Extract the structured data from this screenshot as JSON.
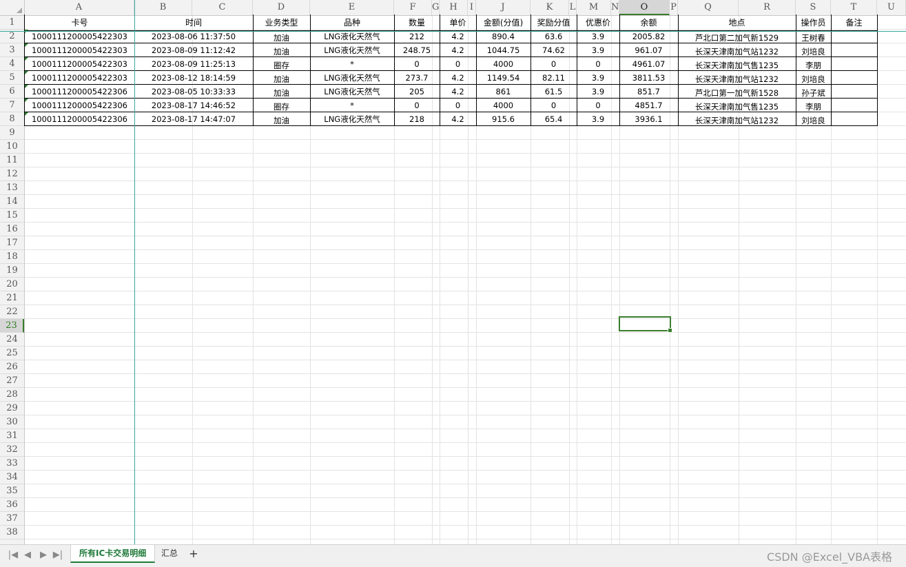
{
  "columns": [
    "A",
    "B",
    "C",
    "D",
    "E",
    "F",
    "G",
    "H",
    "I",
    "J",
    "K",
    "L",
    "M",
    "N",
    "O",
    "P",
    "Q",
    "R",
    "S",
    "T",
    "U"
  ],
  "selected_column": "O",
  "row_numbers": [
    "1",
    "2",
    "3",
    "4",
    "5",
    "6",
    "7",
    "8",
    "9",
    "10",
    "11",
    "12",
    "13",
    "14",
    "15",
    "16",
    "17",
    "18",
    "19",
    "20",
    "21",
    "22",
    "23",
    "24",
    "25",
    "26",
    "27",
    "28",
    "29",
    "30",
    "31",
    "32",
    "33",
    "34",
    "35",
    "36",
    "37",
    "38"
  ],
  "selected_row": "23",
  "headers": [
    "卡号",
    "时间",
    "业务类型",
    "品种",
    "数量",
    "单价",
    "金额(分值)",
    "奖励分值",
    "优惠价",
    "余额",
    "地点",
    "操作员",
    "备注"
  ],
  "rows": [
    [
      "1000111200005422303",
      "2023-08-06 11:37:50",
      "加油",
      "LNG液化天然气",
      "212",
      "4.2",
      "890.4",
      "63.6",
      "3.9",
      "2005.82",
      "芦北口第二加气新1529",
      "王树春",
      ""
    ],
    [
      "1000111200005422303",
      "2023-08-09 11:12:42",
      "加油",
      "LNG液化天然气",
      "248.75",
      "4.2",
      "1044.75",
      "74.62",
      "3.9",
      "961.07",
      "长深天津南加气站1232",
      "刘培良",
      ""
    ],
    [
      "1000111200005422303",
      "2023-08-09 11:25:13",
      "圈存",
      "*",
      "0",
      "0",
      "4000",
      "0",
      "0",
      "4961.07",
      "长深天津南加气售1235",
      "李朋",
      ""
    ],
    [
      "1000111200005422303",
      "2023-08-12 18:14:59",
      "加油",
      "LNG液化天然气",
      "273.7",
      "4.2",
      "1149.54",
      "82.11",
      "3.9",
      "3811.53",
      "长深天津南加气站1232",
      "刘培良",
      ""
    ],
    [
      "1000111200005422306",
      "2023-08-05 10:33:33",
      "加油",
      "LNG液化天然气",
      "205",
      "4.2",
      "861",
      "61.5",
      "3.9",
      "851.7",
      "芦北口第一加气新1528",
      "孙子斌",
      ""
    ],
    [
      "1000111200005422306",
      "2023-08-17 14:46:52",
      "圈存",
      "*",
      "0",
      "0",
      "4000",
      "0",
      "0",
      "4851.7",
      "长深天津南加气售1235",
      "李朋",
      ""
    ],
    [
      "1000111200005422306",
      "2023-08-17 14:47:07",
      "加油",
      "LNG液化天然气",
      "218",
      "4.2",
      "915.6",
      "65.4",
      "3.9",
      "3936.1",
      "长深天津南加气站1232",
      "刘培良",
      ""
    ]
  ],
  "tabs": {
    "nav_first": "|◀",
    "nav_prev": "◀",
    "nav_next": "▶",
    "nav_last": "▶|",
    "sheet1": "所有IC卡交易明细",
    "sheet2": "汇总",
    "add": "+"
  },
  "watermark": "CSDN @Excel_VBA表格"
}
